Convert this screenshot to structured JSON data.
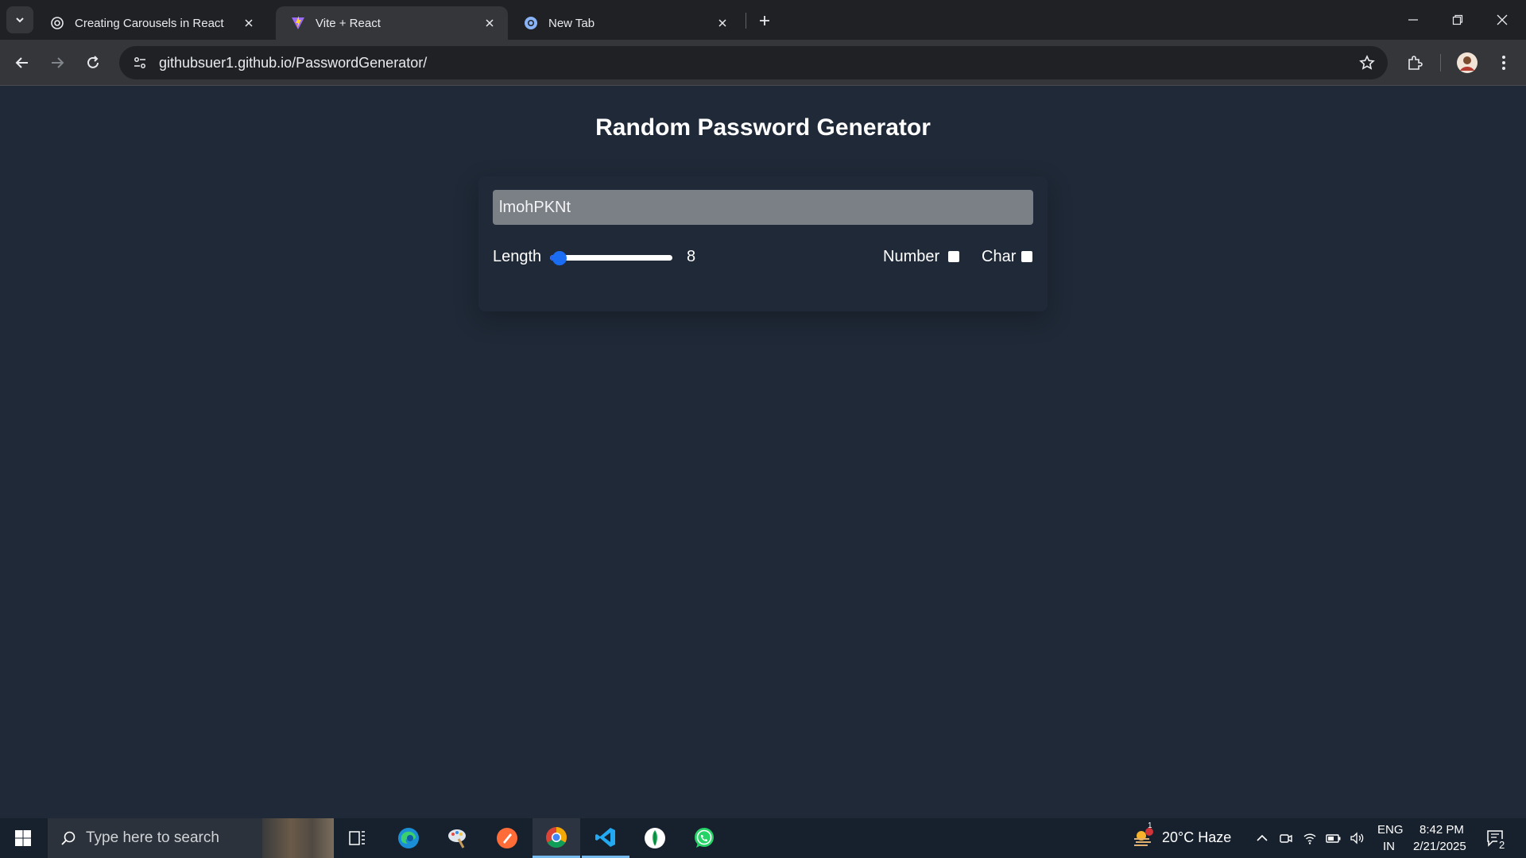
{
  "browser": {
    "tabs": [
      {
        "title": "Creating Carousels in React",
        "icon": "openai-icon",
        "active": false
      },
      {
        "title": "Vite + React",
        "icon": "vite-icon",
        "active": true
      },
      {
        "title": "New Tab",
        "icon": "chrome-newtab-icon",
        "active": false
      }
    ],
    "url": "githubsuer1.github.io/PasswordGenerator/"
  },
  "app": {
    "title": "Random Password Generator",
    "password": "lmohPKNt",
    "length_label": "Length",
    "length_value": "8",
    "length_min": 6,
    "length_max": 100,
    "number_label": "Number",
    "number_checked": false,
    "char_label": "Char",
    "char_checked": false
  },
  "taskbar": {
    "search_placeholder": "Type here to search",
    "pinned": [
      "task-view-icon",
      "edge-icon",
      "paint-icon",
      "postman-icon",
      "chrome-icon",
      "vscode-icon",
      "mongodb-compass-icon",
      "whatsapp-icon"
    ],
    "weather": "20°C  Haze",
    "weather_badge": "1",
    "lang_top": "ENG",
    "lang_bottom": "IN",
    "time": "8:42 PM",
    "date": "2/21/2025",
    "notifications": "2"
  },
  "colors": {
    "page_bg": "#1f2937",
    "accent_blue": "#1a6cf2",
    "input_bg": "#7b7f86"
  }
}
